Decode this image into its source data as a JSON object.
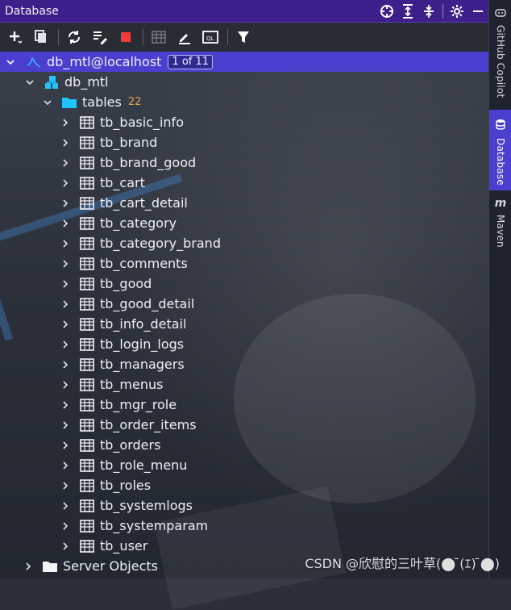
{
  "panel": {
    "title": "Database"
  },
  "toolbar": {
    "icons": [
      "add-icon",
      "duplicate-icon",
      "refresh-icon",
      "schema-icon",
      "stop-icon",
      "table-icon",
      "edit-icon",
      "query-console-icon",
      "filter-icon"
    ]
  },
  "tree": {
    "connection": {
      "label": "db_mtl@localhost",
      "badge": "1 of 11"
    },
    "schema": {
      "label": "db_mtl"
    },
    "tables_folder": {
      "label": "tables",
      "count": "22"
    },
    "tables": [
      "tb_basic_info",
      "tb_brand",
      "tb_brand_good",
      "tb_cart",
      "tb_cart_detail",
      "tb_category",
      "tb_category_brand",
      "tb_comments",
      "tb_good",
      "tb_good_detail",
      "tb_info_detail",
      "tb_login_logs",
      "tb_managers",
      "tb_menus",
      "tb_mgr_role",
      "tb_order_items",
      "tb_orders",
      "tb_role_menu",
      "tb_roles",
      "tb_systemlogs",
      "tb_systemparam",
      "tb_user"
    ],
    "server_objects": {
      "label": "Server Objects"
    }
  },
  "sidebar": {
    "tabs": [
      {
        "label": "GitHub Copilot"
      },
      {
        "label": "Database"
      },
      {
        "label": "Maven"
      }
    ]
  },
  "watermark": "CSDN @欣慰的三叶草(⬤ ̄(ｴ) ̄⬤)",
  "colors": {
    "title_bar": "#3f1f8a",
    "selected_row": "#4b3fcf",
    "count": "#e0a64f",
    "folder": "#20c4ff"
  }
}
